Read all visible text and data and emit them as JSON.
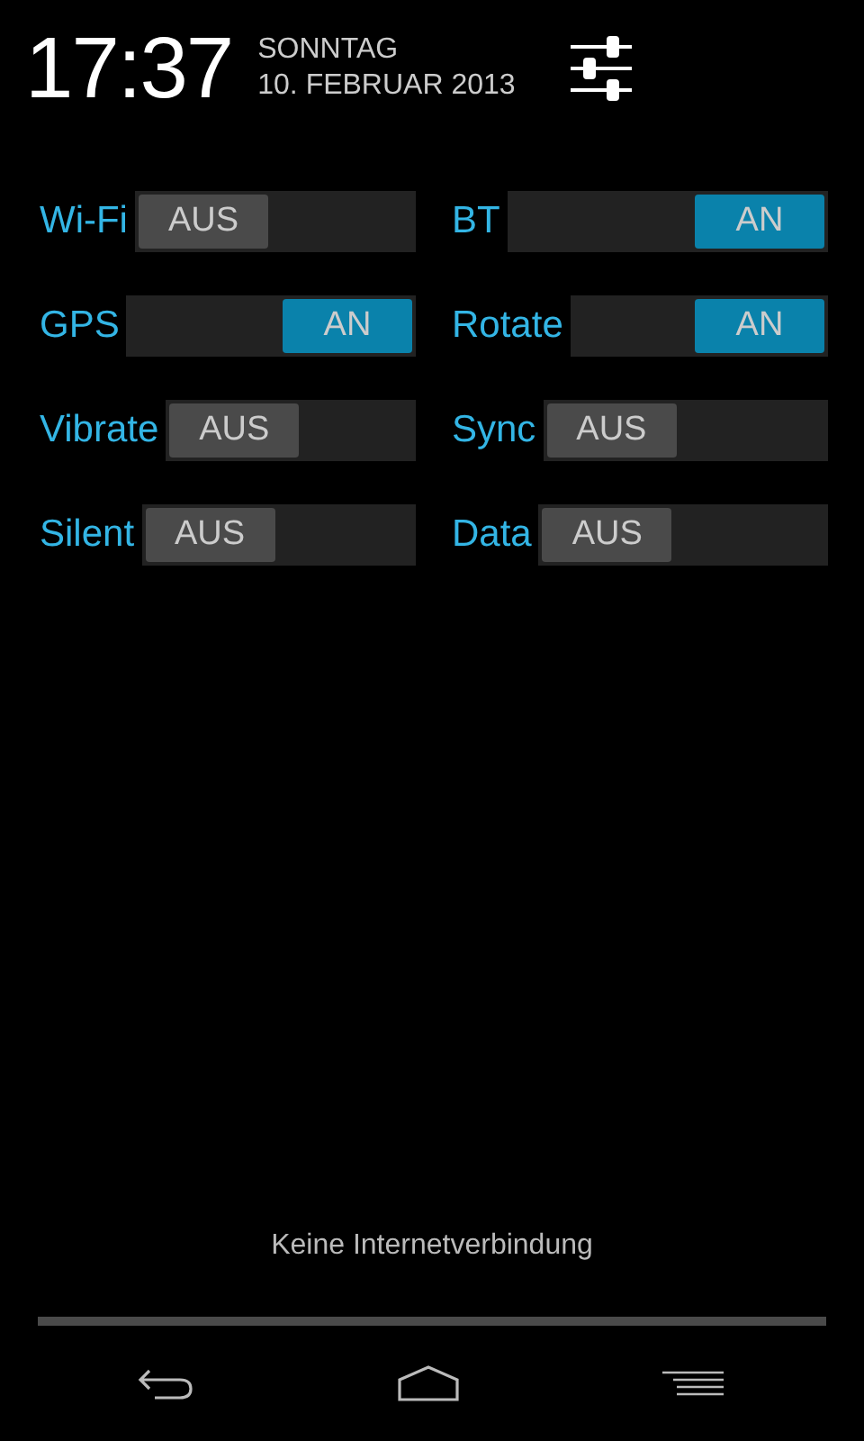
{
  "header": {
    "time": "17:37",
    "weekday": "SONNTAG",
    "date": "10. FEBRUAR 2013"
  },
  "switches": [
    {
      "label": "Wi-Fi",
      "on": false,
      "state_text": "AUS"
    },
    {
      "label": "BT",
      "on": true,
      "state_text": "AN"
    },
    {
      "label": "GPS",
      "on": true,
      "state_text": "AN"
    },
    {
      "label": "Rotate",
      "on": true,
      "state_text": "AN"
    },
    {
      "label": "Vibrate",
      "on": false,
      "state_text": "AUS"
    },
    {
      "label": "Sync",
      "on": false,
      "state_text": "AUS"
    },
    {
      "label": "Silent",
      "on": false,
      "state_text": "AUS"
    },
    {
      "label": "Data",
      "on": false,
      "state_text": "AUS"
    }
  ],
  "status_message": "Keine Internetverbindung"
}
